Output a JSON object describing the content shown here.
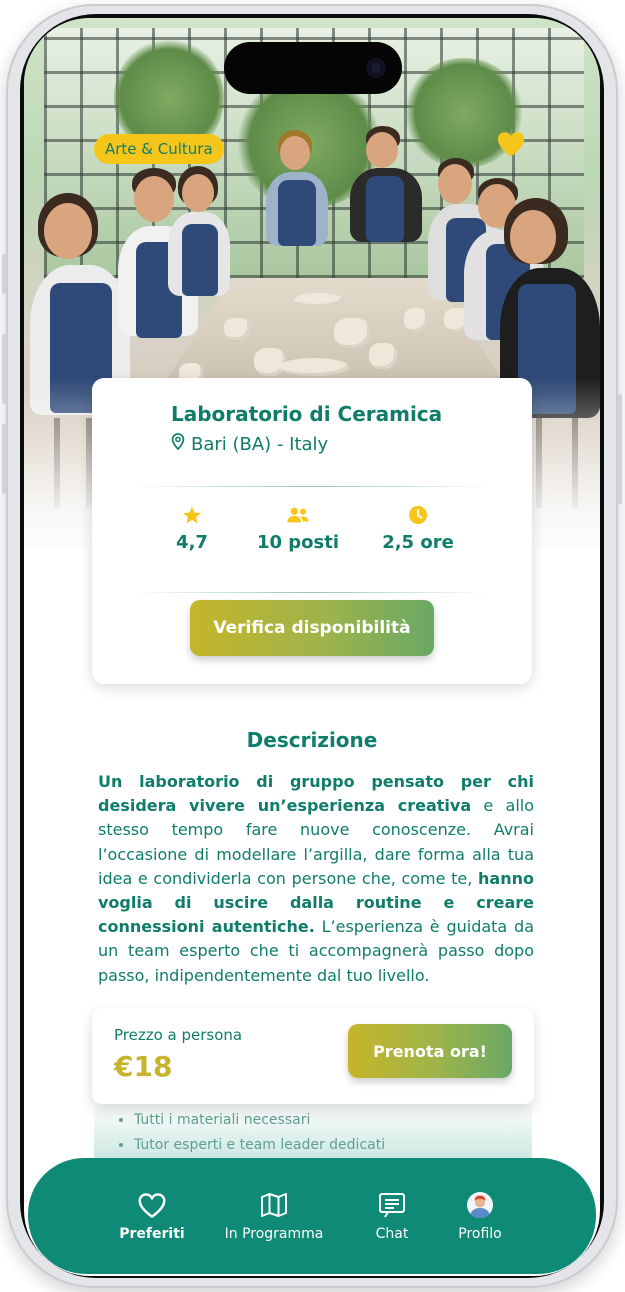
{
  "event": {
    "category": "Arte & Cultura",
    "title": "Laboratorio di Ceramica",
    "location": "Bari (BA) - Italy",
    "stats": {
      "rating": "4,7",
      "seats": "10 posti",
      "duration": "2,5 ore"
    },
    "availability_button": "Verifica disponibilità"
  },
  "description": {
    "heading": "Descrizione",
    "p1_bold": "Un laboratorio di gruppo pensato per chi desidera vivere un’esperienza creativa",
    "p1_rest": " e allo stesso tempo fare nuove conoscenze. Avrai l’occasione di modellare l’argilla, dare forma alla tua idea e condividerla con persone che, come te, ",
    "p2_bold": "hanno voglia di uscire dalla routine e creare connessioni autentiche.",
    "p2_rest": " L’esperienza è guidata da un team esperto che ti accompagnerà passo dopo passo, indipendentemente dal tuo livello."
  },
  "booking": {
    "price_label": "Prezzo a persona",
    "price": "€18",
    "book_button": "Prenota ora!"
  },
  "includes": [
    "Tutti i materiali necessari",
    "Tutor esperti e team leader dedicati"
  ],
  "nav": {
    "items": [
      {
        "label": "Preferiti",
        "icon": "heart-icon"
      },
      {
        "label": "In Programma",
        "icon": "map-icon"
      },
      {
        "label": "Chat",
        "icon": "chat-icon"
      },
      {
        "label": "Profilo",
        "icon": "avatar"
      }
    ],
    "active": "Preferiti"
  },
  "colors": {
    "brand_teal": "#0f7d6a",
    "nav_teal": "#0f8a77",
    "accent_yellow": "#f6c51a",
    "button_olive": "#c6b52a"
  }
}
